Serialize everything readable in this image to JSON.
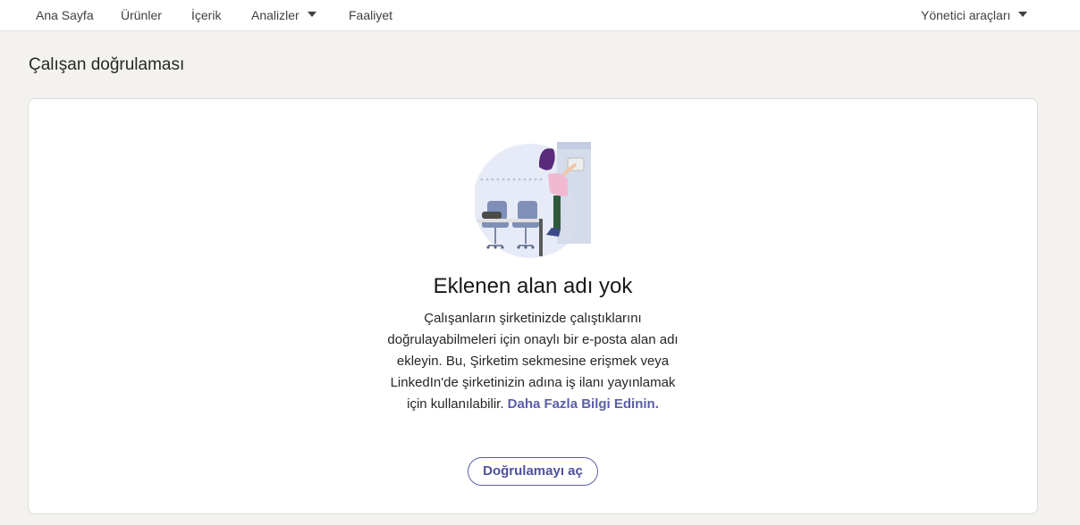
{
  "nav": {
    "home": "Ana Sayfa",
    "products": "Ürünler",
    "content": "İçerik",
    "analytics": "Analizler",
    "activity": "Faaliyet",
    "admin_tools": "Yönetici araçları"
  },
  "page": {
    "title": "Çalışan doğrulaması"
  },
  "empty_state": {
    "title": "Eklenen alan adı yok",
    "description": "Çalışanların şirketinizde çalıştıklarını doğrulayabilmeleri için onaylı bir e-posta alan adı ekleyin. Bu, Şirketim sekmesine erişmek veya LinkedIn'de şirketinizin adına iş ilanı yayınlamak için kullanılabilir.",
    "learn_more": "Daha Fazla Bilgi Edinin.",
    "button": "Doğrulamayı aç"
  },
  "colors": {
    "accent": "#5b5ea6",
    "background": "#f3f2ef"
  },
  "icons": {
    "analytics_dropdown": "caret-down-icon",
    "admin_dropdown": "caret-down-icon",
    "illustration": "office-worker-illustration"
  }
}
